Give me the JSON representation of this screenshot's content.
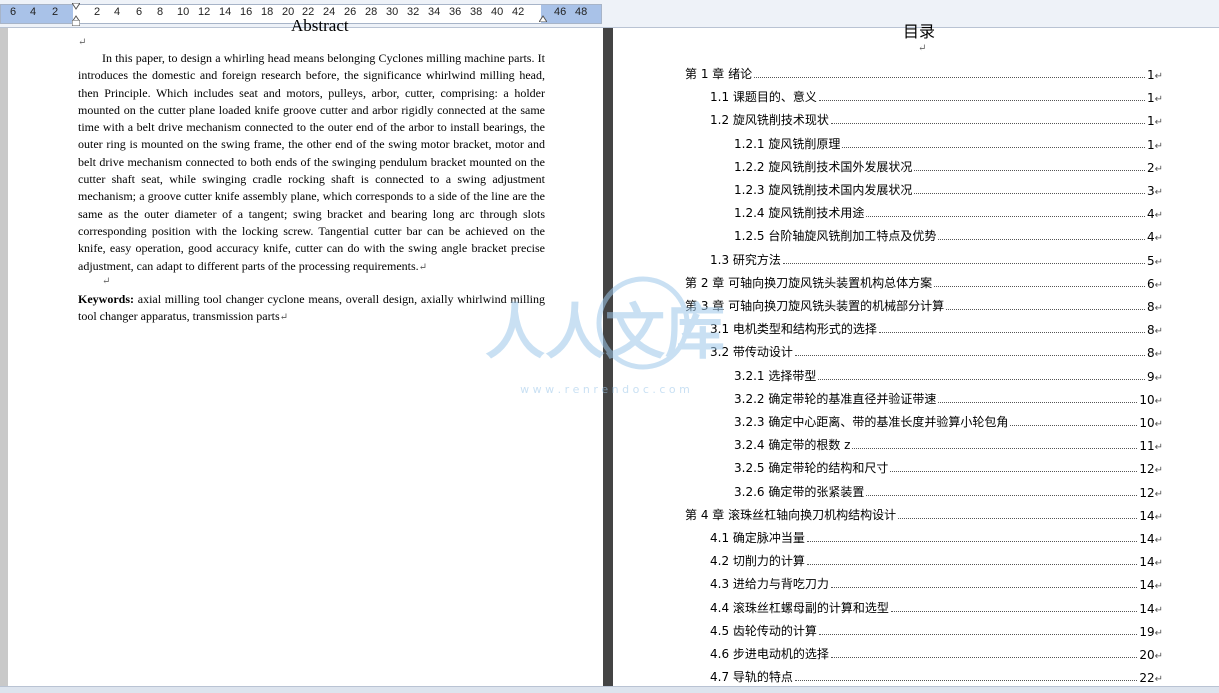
{
  "ruler": {
    "ticks": [
      "6",
      "4",
      "2",
      "2",
      "4",
      "6",
      "8",
      "10",
      "12",
      "14",
      "16",
      "18",
      "20",
      "22",
      "24",
      "26",
      "28",
      "30",
      "32",
      "34",
      "36",
      "38",
      "40",
      "42",
      "46",
      "48"
    ]
  },
  "abstract": {
    "title": "Abstract",
    "body": "In this paper, to design a whirling head means belonging Cyclones milling machine parts. It introduces the domestic and foreign research before, the significance whirlwind milling head, then Principle. Which includes seat and motors, pulleys, arbor, cutter, comprising: a holder mounted on the cutter plane loaded knife groove cutter and arbor rigidly connected at the same time with a belt drive mechanism connected to the outer end of the arbor to install bearings, the outer ring is mounted on the swing frame, the other end of the swing motor bracket, motor and belt drive mechanism connected to both ends of the swinging pendulum bracket mounted on the cutter shaft seat, while swinging cradle rocking shaft is connected to a swing adjustment mechanism; a groove cutter knife assembly plane, which corresponds to a side of the line are the same as the outer diameter of a tangent; swing bracket and bearing long arc through slots corresponding position with the locking screw. Tangential cutter bar can be achieved on the knife, easy operation, good accuracy knife, cutter can do with the swing angle bracket precise adjustment, can adapt to different parts of the processing requirements.",
    "keywords_label": "Keywords:",
    "keywords": "axial milling tool changer cyclone means, overall design, axially whirlwind milling tool changer apparatus, transmission parts"
  },
  "toc": {
    "title": "目录",
    "entries": [
      {
        "label": "第 1 章  绪论",
        "page": "1"
      },
      {
        "label": "1.1 课题目的、意义",
        "page": "1"
      },
      {
        "label": "1.2 旋风铣削技术现状",
        "page": "1"
      },
      {
        "label": "1.2.1  旋风铣削原理",
        "page": "1"
      },
      {
        "label": "1.2.2  旋风铣削技术国外发展状况",
        "page": "2"
      },
      {
        "label": "1.2.3  旋风铣削技术国内发展状况",
        "page": "3"
      },
      {
        "label": "1.2.4  旋风铣削技术用途",
        "page": "4"
      },
      {
        "label": "1.2.5  台阶轴旋风铣削加工特点及优势",
        "page": "4"
      },
      {
        "label": "1.3 研究方法",
        "page": "5"
      },
      {
        "label": "第 2 章   可轴向换刀旋风铣头装置机构总体方案",
        "page": "6"
      },
      {
        "label": "第 3 章   可轴向换刀旋风铣头装置的机械部分计算",
        "page": "8"
      },
      {
        "label": "3.1 电机类型和结构形式的选择",
        "page": "8"
      },
      {
        "label": "3.2 带传动设计",
        "page": "8"
      },
      {
        "label": "3.2.1  选择带型",
        "page": "9"
      },
      {
        "label": "3.2.2 确定带轮的基准直径并验证带速",
        "page": "10"
      },
      {
        "label": "3.2.3  确定中心距离、带的基准长度并验算小轮包角",
        "page": "10"
      },
      {
        "label": "3.2.4 确定带的根数 z",
        "page": "11"
      },
      {
        "label": "3.2.5 确定带轮的结构和尺寸",
        "page": "12"
      },
      {
        "label": "3.2.6  确定带的张紧装置",
        "page": "12"
      },
      {
        "label": "第 4 章  滚珠丝杠轴向换刀机构结构设计",
        "page": "14"
      },
      {
        "label": "4.1  确定脉冲当量",
        "page": "14"
      },
      {
        "label": "4.2  切削力的计算",
        "page": "14"
      },
      {
        "label": "4.3  进给力与背吃刀力",
        "page": "14"
      },
      {
        "label": "4.4  滚珠丝杠螺母副的计算和选型",
        "page": "14"
      },
      {
        "label": "4.5  齿轮传动的计算",
        "page": "19"
      },
      {
        "label": "4.6  步进电动机的选择",
        "page": "20"
      },
      {
        "label": "4.7  导轨的特点",
        "page": "22"
      }
    ]
  },
  "watermark": {
    "text": "人人文库",
    "url": "w w w . r e n r e n d o c . c o m"
  },
  "colors": {
    "ruler_margin": "#a9c2e8",
    "divider": "#444444",
    "watermark": "#9ec8ea"
  }
}
